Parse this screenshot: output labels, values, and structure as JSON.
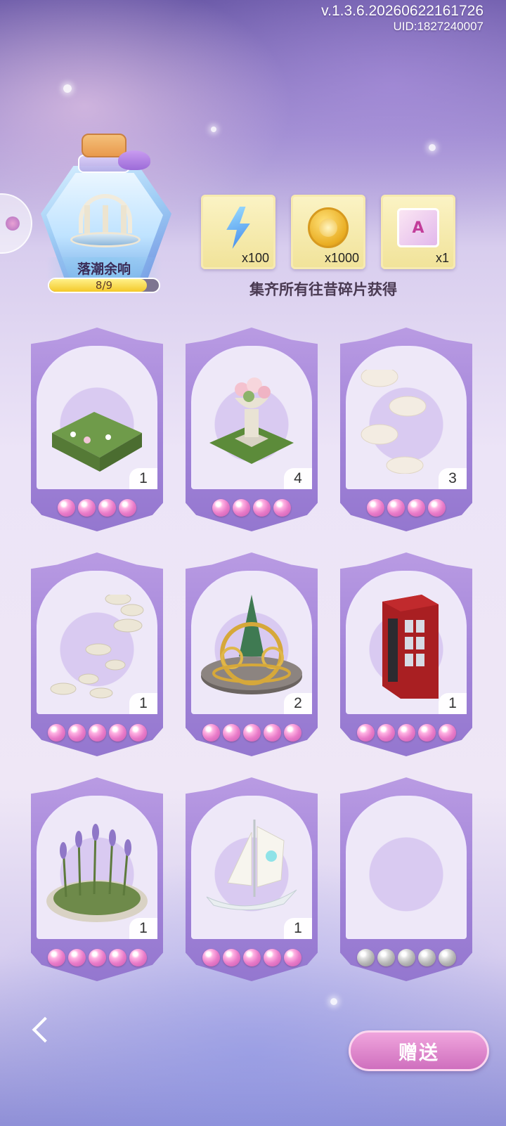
{
  "header": {
    "version": "v.1.3.6.20260622161726",
    "uid": "UID:1827240007"
  },
  "collection": {
    "name": "落潮余响",
    "progress_text": "8/9",
    "progress_fraction": 0.89
  },
  "rewards": {
    "items": [
      {
        "icon": "energy-bolt-icon",
        "count": "x100"
      },
      {
        "icon": "gold-coin-icon",
        "count": "x1000"
      },
      {
        "icon": "card-book-icon",
        "count": "x1"
      }
    ],
    "caption": "集齐所有往昔碎片获得"
  },
  "cards": [
    {
      "item": "hedge-garden-icon",
      "count": "1",
      "pearls": 4,
      "collected": true
    },
    {
      "item": "flower-urn-pedestal-icon",
      "count": "4",
      "pearls": 4,
      "collected": true
    },
    {
      "item": "round-stepping-stones-icon",
      "count": "3",
      "pearls": 4,
      "collected": true
    },
    {
      "item": "stone-path-icon",
      "count": "1",
      "pearls": 5,
      "collected": true
    },
    {
      "item": "clockwork-carousel-icon",
      "count": "2",
      "pearls": 5,
      "collected": true
    },
    {
      "item": "telephone-booth-icon",
      "count": "1",
      "pearls": 5,
      "collected": true
    },
    {
      "item": "lavender-bed-icon",
      "count": "1",
      "pearls": 5,
      "collected": true
    },
    {
      "item": "sailing-ship-icon",
      "count": "1",
      "pearls": 5,
      "collected": true
    },
    {
      "item": "empty-slot",
      "count": "",
      "pearls": 5,
      "collected": false
    }
  ],
  "footer": {
    "gift_label": "赠送"
  },
  "colors": {
    "pearl_pink": "#e97cc9",
    "pearl_grey": "#b8b8b8",
    "card_frame": "#a183d8"
  }
}
